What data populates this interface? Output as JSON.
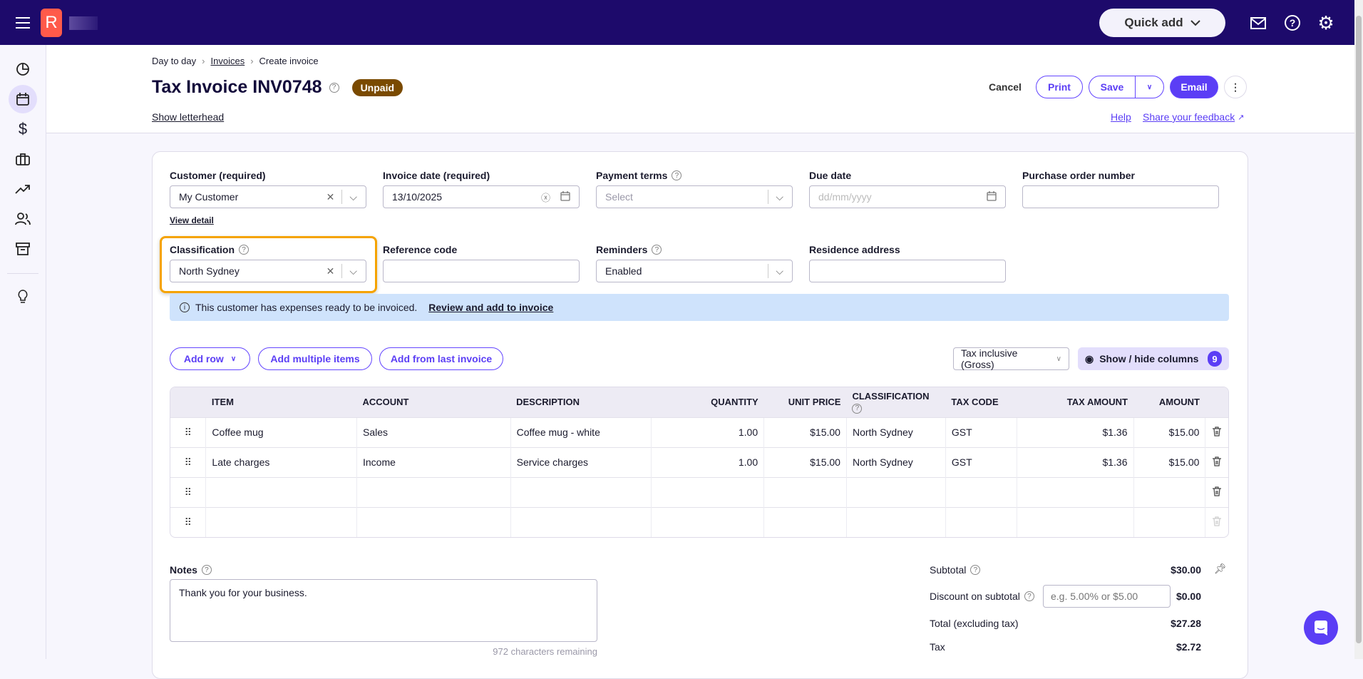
{
  "header": {
    "logo_letter": "R",
    "quick_add": "Quick add"
  },
  "breadcrumb": {
    "items": [
      "Day to day",
      "Invoices",
      "Create invoice"
    ]
  },
  "page": {
    "title": "Tax Invoice INV0748",
    "status": "Unpaid",
    "show_letterhead": "Show letterhead",
    "help": "Help",
    "feedback": "Share your feedback"
  },
  "actions": {
    "cancel": "Cancel",
    "print": "Print",
    "save": "Save",
    "email": "Email"
  },
  "form": {
    "customer": {
      "label": "Customer (required)",
      "value": "My Customer",
      "view_detail": "View detail"
    },
    "invoice_date": {
      "label": "Invoice date (required)",
      "value": "13/10/2025"
    },
    "payment_terms": {
      "label": "Payment terms",
      "placeholder": "Select"
    },
    "due_date": {
      "label": "Due date",
      "placeholder": "dd/mm/yyyy"
    },
    "po_number": {
      "label": "Purchase order number",
      "value": ""
    },
    "classification": {
      "label": "Classification",
      "value": "North Sydney"
    },
    "reference_code": {
      "label": "Reference code",
      "value": ""
    },
    "reminders": {
      "label": "Reminders",
      "value": "Enabled"
    },
    "residence_address": {
      "label": "Residence address",
      "value": ""
    }
  },
  "banner": {
    "text": "This customer has expenses ready to be invoiced.",
    "link": "Review and add to invoice"
  },
  "toolbar": {
    "add_row": "Add row",
    "add_multiple": "Add multiple items",
    "add_last": "Add from last invoice",
    "tax_mode": "Tax inclusive (Gross)",
    "show_hide": "Show / hide columns",
    "column_count": "9"
  },
  "table": {
    "headers": [
      "ITEM",
      "ACCOUNT",
      "DESCRIPTION",
      "QUANTITY",
      "UNIT PRICE",
      "CLASSIFICATION",
      "TAX CODE",
      "TAX AMOUNT",
      "AMOUNT"
    ],
    "rows": [
      [
        "Coffee mug",
        "Sales",
        "Coffee mug - white",
        "1.00",
        "$15.00",
        "North Sydney",
        "GST",
        "$1.36",
        "$15.00"
      ],
      [
        "Late charges",
        "Income",
        "Service charges",
        "1.00",
        "$15.00",
        "North Sydney",
        "GST",
        "$1.36",
        "$15.00"
      ],
      [
        "",
        "",
        "",
        "",
        "",
        "",
        "",
        "",
        ""
      ],
      [
        "",
        "",
        "",
        "",
        "",
        "",
        "",
        "",
        ""
      ]
    ]
  },
  "notes": {
    "label": "Notes",
    "value": "Thank you for your business.",
    "remaining": "972 characters remaining"
  },
  "totals": {
    "subtotal_label": "Subtotal",
    "subtotal": "$30.00",
    "discount_label": "Discount on subtotal",
    "discount_placeholder": "e.g. 5.00% or $5.00",
    "discount": "$0.00",
    "total_ex_label": "Total (excluding tax)",
    "total_ex": "$27.28",
    "tax_label": "Tax",
    "tax": "$2.72"
  }
}
